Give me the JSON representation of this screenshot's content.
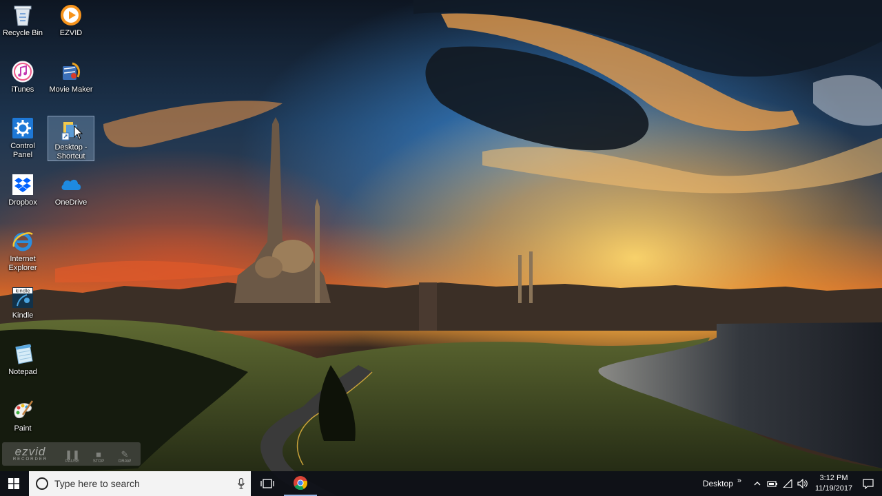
{
  "desktop_icons": [
    {
      "label": "Recycle Bin",
      "icon": "recycle-bin-icon"
    },
    {
      "label": "EZVID",
      "icon": "ezvid-icon"
    },
    {
      "label": "iTunes",
      "icon": "itunes-icon"
    },
    {
      "label": "Movie Maker",
      "icon": "movie-maker-icon"
    },
    {
      "label": "Control Panel",
      "icon": "control-panel-icon"
    },
    {
      "label": "Desktop - Shortcut",
      "icon": "folder-shortcut-icon",
      "selected": true
    },
    {
      "label": "Dropbox",
      "icon": "dropbox-icon"
    },
    {
      "label": "OneDrive",
      "icon": "onedrive-icon"
    },
    {
      "label": "Internet Explorer",
      "icon": "internet-explorer-icon"
    },
    {
      "label": "Kindle",
      "icon": "kindle-icon"
    },
    {
      "label": "Notepad",
      "icon": "notepad-icon"
    },
    {
      "label": "Paint",
      "icon": "paint-icon"
    }
  ],
  "ezvid_recorder": {
    "logo": "ezvid",
    "sub": "RECORDER",
    "buttons": [
      "PAUSE",
      "STOP",
      "DRAW"
    ]
  },
  "taskbar": {
    "search_placeholder": "Type here to search",
    "tray_toolbar_label": "Desktop",
    "tray_expand": "»",
    "time": "3:12 PM",
    "date": "11/19/2017"
  },
  "colors": {
    "taskbar": "#0e1018",
    "accent": "#9ab8e6"
  }
}
